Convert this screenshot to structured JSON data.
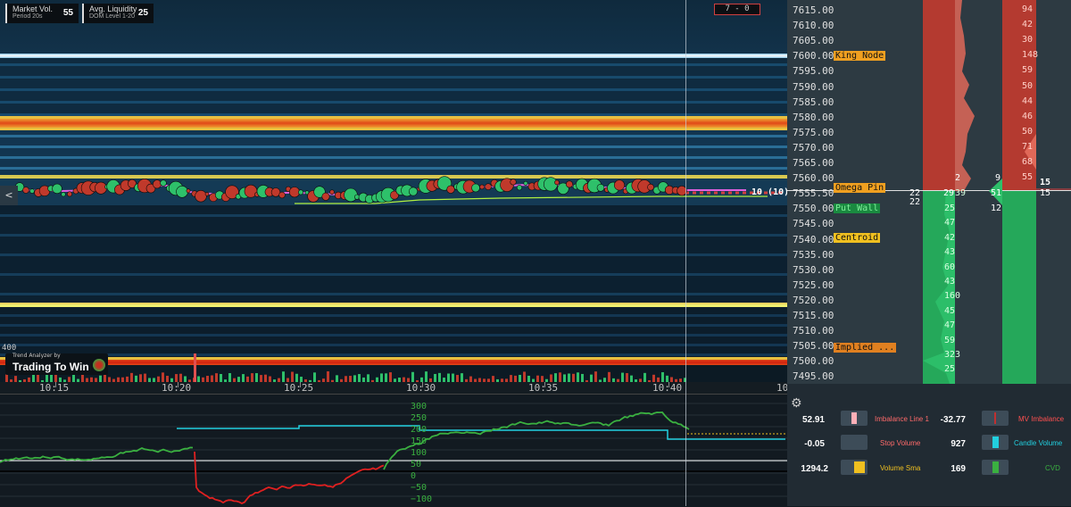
{
  "colors": {
    "heat_bg": "#0b1a26",
    "bid_green": "#26b35a",
    "ask_red": "#c0392b",
    "cvd_green": "#3ab040",
    "cvd_red": "#e02020",
    "cyan": "#22d0e0",
    "king_tag": "#f0a020",
    "put_tag": "#1a8a40"
  },
  "stats": [
    {
      "title": "Market Vol.",
      "subtitle": "Period 20s",
      "value": "55"
    },
    {
      "title": "Avg. Liquidity",
      "subtitle": "DOM Level 1-20",
      "value": "25"
    }
  ],
  "scale_badge": "7 - 0",
  "back_button": "<",
  "volume_label": "400",
  "brand": {
    "small": "Trend Analyzer by",
    "big": "Trading To Win"
  },
  "last_trade_label": "10 (10)",
  "time_ticks": [
    "10:15",
    "10:20",
    "10:25",
    "10:30",
    "10:35",
    "10:40",
    "10"
  ],
  "cvd_axis": [
    "300",
    "250",
    "200",
    "150",
    "100",
    "50",
    "0",
    "−50",
    "−100"
  ],
  "prices": [
    "7615.00",
    "7610.00",
    "7605.00",
    "7600.00",
    "7595.00",
    "7590.00",
    "7585.00",
    "7580.00",
    "7575.00",
    "7570.00",
    "7565.00",
    "7560.00",
    "7555.50",
    "7550.00",
    "7545.00",
    "7540.00",
    "7535.00",
    "7530.00",
    "7525.00",
    "7520.00",
    "7515.00",
    "7510.00",
    "7505.00",
    "7500.00",
    "7495.00"
  ],
  "level_tags": {
    "king_node": "King Node",
    "omega_pin": "Omega Pin",
    "put_wall": "Put Wall",
    "centroid": "Centroid",
    "implied": "Implied ..."
  },
  "ask_sizes": [
    "94",
    "42",
    "30",
    "148",
    "59",
    "50",
    "44",
    "46",
    "50",
    "71",
    "68",
    "55"
  ],
  "bid_sizes": [
    "39",
    "25",
    "47",
    "42",
    "43",
    "60",
    "43",
    "160",
    "45",
    "47",
    "59",
    "323",
    "25"
  ],
  "profile_labels": {
    "mid_left_top": "22",
    "mid_left_bottom": "22",
    "mid_a": "29",
    "mid_b": "2",
    "mid_c": "9",
    "mid_d": "51",
    "mid_e": "12",
    "last_top": "15",
    "last_bottom": "15"
  },
  "legend": [
    {
      "value": "52.91",
      "label": "Imbalance Line 1",
      "label_color": "#ff6a6a",
      "swatch": "#ffb0b8"
    },
    {
      "value": "-32.77",
      "label": "MV Imbalance",
      "label_color": "#ff5050",
      "swatch": "#c03030"
    },
    {
      "value": "-0.05",
      "label": "Stop Volume",
      "label_color": "#ff6a6a",
      "swatch": "#3d4c58"
    },
    {
      "value": "927",
      "label": "Candle Volume",
      "label_color": "#22d0e0",
      "swatch": "#22d0e0"
    },
    {
      "value": "1294.2",
      "label": "Volume Sma",
      "label_color": "#f0c020",
      "swatch": "#f0c020"
    },
    {
      "value": "169",
      "label": "CVD",
      "label_color": "#3ab040",
      "swatch": "#3ab040"
    }
  ]
}
